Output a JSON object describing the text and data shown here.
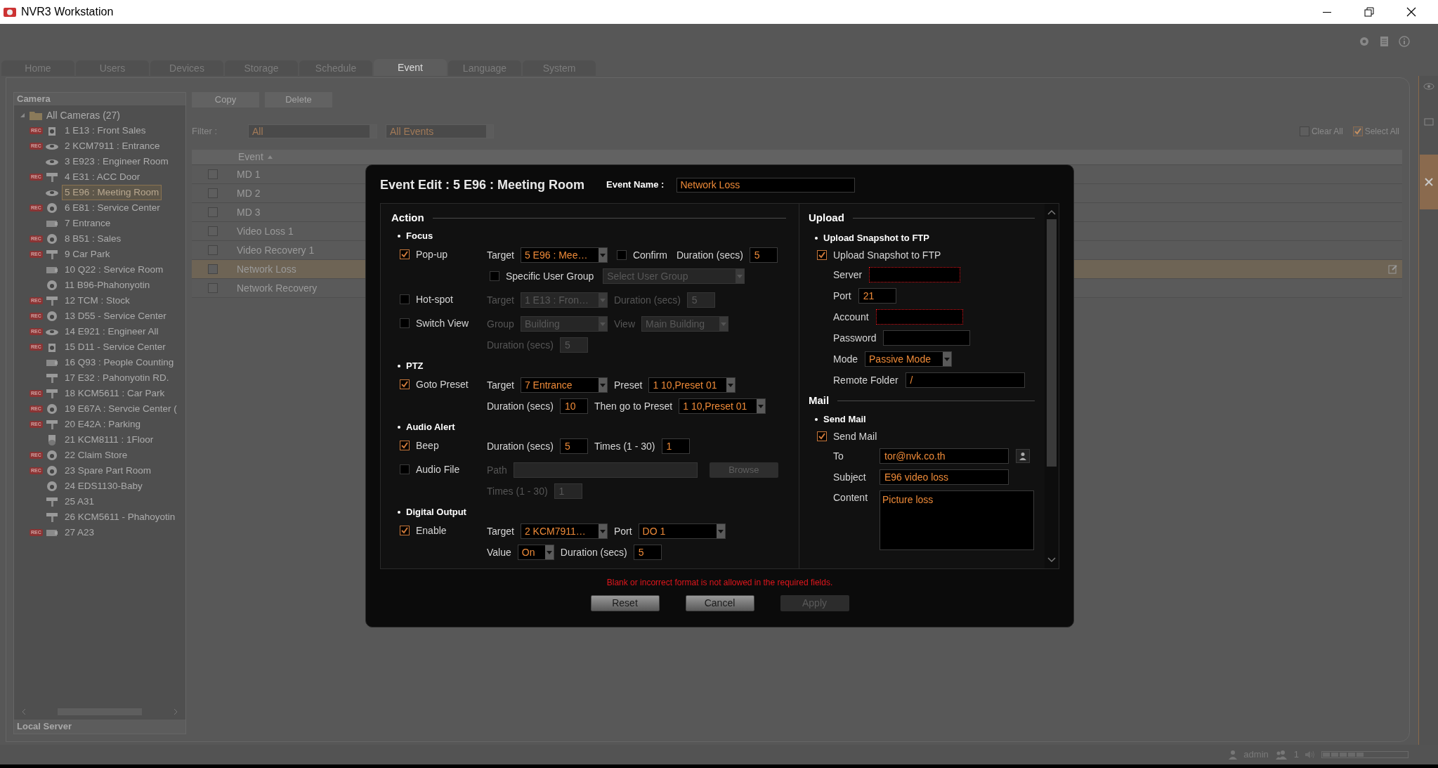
{
  "window": {
    "title": "NVR3 Workstation"
  },
  "tabs": [
    {
      "label": "Home",
      "selected": false
    },
    {
      "label": "Users",
      "selected": false
    },
    {
      "label": "Devices",
      "selected": false
    },
    {
      "label": "Storage",
      "selected": false
    },
    {
      "label": "Schedule",
      "selected": false
    },
    {
      "label": "Event",
      "selected": true
    },
    {
      "label": "Language",
      "selected": false
    },
    {
      "label": "System",
      "selected": false
    }
  ],
  "camera_panel": {
    "title": "Camera",
    "root": {
      "label": "All Cameras (27)",
      "expanded": true,
      "children": [
        {
          "label": "1 E13 : Front Sales",
          "badge": "REC",
          "kind": "cube",
          "selected": false
        },
        {
          "label": "2 KCM7911 : Entrance",
          "badge": "REC",
          "kind": "fisheye",
          "selected": false
        },
        {
          "label": "3 E923 : Engineer Room",
          "kind": "fisheye",
          "selected": false
        },
        {
          "label": "4 E31 : ACC Door",
          "badge": "REC",
          "kind": "bullet",
          "selected": false
        },
        {
          "label": "5 E96 : Meeting Room",
          "kind": "fisheye",
          "selected": true
        },
        {
          "label": "6 E81 : Service Center",
          "badge": "REC",
          "kind": "dome",
          "selected": false
        },
        {
          "label": "7 Entrance",
          "kind": "box",
          "selected": false
        },
        {
          "label": "8 B51 : Sales",
          "badge": "REC",
          "kind": "dome",
          "selected": false
        },
        {
          "label": "9 Car Park",
          "badge": "REC",
          "kind": "bullet",
          "selected": false
        },
        {
          "label": "10 Q22 : Service Room",
          "kind": "box",
          "selected": false
        },
        {
          "label": "11 B96-Phahonyotin",
          "kind": "dome",
          "selected": false
        },
        {
          "label": "12 TCM : Stock",
          "badge": "REC",
          "kind": "bullet",
          "selected": false
        },
        {
          "label": "13 D55 - Service Center",
          "badge": "REC",
          "kind": "dome",
          "selected": false
        },
        {
          "label": "14 E921 : Engineer All",
          "badge": "REC",
          "kind": "fisheye",
          "selected": false
        },
        {
          "label": "15 D11 - Service Center",
          "badge": "REC",
          "kind": "cube",
          "selected": false
        },
        {
          "label": "16 Q93 : People Counting",
          "kind": "box",
          "selected": false
        },
        {
          "label": "17 E32 : Pahonyotin RD.",
          "kind": "bullet",
          "selected": false
        },
        {
          "label": "18 KCM5611 : Car Park",
          "badge": "REC",
          "kind": "bullet",
          "selected": false
        },
        {
          "label": "19 E67A : Servcie Center (",
          "badge": "REC",
          "kind": "dome",
          "selected": false
        },
        {
          "label": "20 E42A : Parking",
          "badge": "REC",
          "kind": "bullet",
          "selected": false
        },
        {
          "label": "21 KCM8111 : 1Floor",
          "kind": "ptz",
          "selected": false
        },
        {
          "label": "22 Claim Store",
          "badge": "REC",
          "kind": "dome",
          "selected": false
        },
        {
          "label": "23 Spare Part Room",
          "badge": "REC",
          "kind": "dome",
          "selected": false
        },
        {
          "label": "24 EDS1130-Baby",
          "kind": "dome",
          "selected": false
        },
        {
          "label": "25 A31",
          "kind": "bullet",
          "selected": false
        },
        {
          "label": "26 KCM5611 - Phahoyotin",
          "kind": "bullet",
          "selected": false
        },
        {
          "label": "27 A23",
          "badge": "REC",
          "kind": "box",
          "selected": false
        }
      ]
    },
    "footer": "Local Server"
  },
  "toolbar": {
    "buttons": [
      "Copy",
      "Delete"
    ],
    "filter_label": "Filter :",
    "filters": [
      "All",
      "All Events"
    ],
    "toggles": [
      {
        "label": "Clear All",
        "checked": false
      },
      {
        "label": "Select All",
        "checked": true
      }
    ]
  },
  "table": {
    "columns": [
      "Event"
    ],
    "rows": [
      {
        "event": "MD 1",
        "checked": false,
        "selected": false
      },
      {
        "event": "MD 2",
        "checked": false,
        "selected": false
      },
      {
        "event": "MD 3",
        "checked": false,
        "selected": false
      },
      {
        "event": "Video Loss 1",
        "checked": false,
        "selected": false
      },
      {
        "event": "Video Recovery 1",
        "checked": false,
        "selected": false
      },
      {
        "event": "Network Loss",
        "checked": false,
        "selected": true
      },
      {
        "event": "Network Recovery",
        "checked": false,
        "selected": false
      }
    ]
  },
  "dialog": {
    "title": "Event Edit : 5 E96 : Meeting Room",
    "name_label": "Event Name :",
    "name_value": "Network Loss",
    "action": {
      "title": "Action",
      "sections": [
        {
          "title": "Focus",
          "items": [
            {
              "label": "Pop-up",
              "checked": true,
              "lines": [
                {
                  "fields": [
                    {
                      "kind": "label",
                      "text": "Target",
                      "disabled": false
                    },
                    {
                      "kind": "select",
                      "value": "5 E96 : Mee…",
                      "disabled": false
                    },
                    {
                      "kind": "checkbox",
                      "text": "Confirm",
                      "checked": false,
                      "disabled": false
                    },
                    {
                      "kind": "label",
                      "text": "Duration (secs)",
                      "disabled": false
                    },
                    {
                      "kind": "input",
                      "value": "5",
                      "disabled": false
                    }
                  ]
                },
                {
                  "fields": [
                    {
                      "kind": "checkbox",
                      "text": "Specific User Group",
                      "checked": false,
                      "disabled": false
                    },
                    {
                      "kind": "select",
                      "value": "Select User Group",
                      "disabled": true
                    }
                  ]
                }
              ]
            },
            {
              "label": "Hot-spot",
              "checked": false,
              "lines": [
                {
                  "fields": [
                    {
                      "kind": "label",
                      "text": "Target",
                      "disabled": true
                    },
                    {
                      "kind": "select",
                      "value": "1 E13 : Fron…",
                      "disabled": true
                    },
                    {
                      "kind": "label",
                      "text": "Duration (secs)",
                      "disabled": true
                    },
                    {
                      "kind": "input",
                      "value": "5",
                      "disabled": true
                    }
                  ]
                }
              ]
            },
            {
              "label": "Switch View",
              "checked": false,
              "lines": [
                {
                  "fields": [
                    {
                      "kind": "label",
                      "text": "Group",
                      "disabled": true
                    },
                    {
                      "kind": "select",
                      "value": "Building",
                      "disabled": true
                    },
                    {
                      "kind": "label",
                      "text": "View",
                      "disabled": true
                    },
                    {
                      "kind": "select",
                      "value": "Main Building",
                      "disabled": true
                    }
                  ]
                },
                {
                  "fields": [
                    {
                      "kind": "label",
                      "text": "Duration (secs)",
                      "disabled": true
                    },
                    {
                      "kind": "input",
                      "value": "5",
                      "disabled": true
                    }
                  ]
                }
              ]
            }
          ]
        },
        {
          "title": "PTZ",
          "items": [
            {
              "label": "Goto Preset",
              "checked": true,
              "lines": [
                {
                  "fields": [
                    {
                      "kind": "label",
                      "text": "Target",
                      "disabled": false
                    },
                    {
                      "kind": "select",
                      "value": "7 Entrance",
                      "disabled": false
                    },
                    {
                      "kind": "label",
                      "text": "Preset",
                      "disabled": false
                    },
                    {
                      "kind": "select",
                      "value": "1 10,Preset 01",
                      "disabled": false
                    }
                  ]
                },
                {
                  "fields": [
                    {
                      "kind": "label",
                      "text": "Duration (secs)",
                      "disabled": false
                    },
                    {
                      "kind": "input",
                      "value": "10",
                      "disabled": false
                    },
                    {
                      "kind": "label",
                      "text": "Then go to Preset",
                      "disabled": false
                    },
                    {
                      "kind": "select",
                      "value": "1 10,Preset 01",
                      "disabled": false
                    }
                  ]
                }
              ]
            }
          ]
        },
        {
          "title": "Audio Alert",
          "items": [
            {
              "label": "Beep",
              "checked": true,
              "lines": [
                {
                  "fields": [
                    {
                      "kind": "label",
                      "text": "Duration (secs)",
                      "disabled": false
                    },
                    {
                      "kind": "input",
                      "value": "5",
                      "disabled": false
                    },
                    {
                      "kind": "label",
                      "text": "Times (1 - 30)",
                      "disabled": false
                    },
                    {
                      "kind": "input",
                      "value": "1",
                      "disabled": false
                    }
                  ]
                }
              ]
            },
            {
              "label": "Audio File",
              "checked": false,
              "lines": [
                {
                  "fields": [
                    {
                      "kind": "label",
                      "text": "Path",
                      "disabled": true
                    },
                    {
                      "kind": "input",
                      "disabled": true
                    },
                    {
                      "kind": "button",
                      "text": "Browse",
                      "disabled": true
                    }
                  ]
                },
                {
                  "fields": [
                    {
                      "kind": "label",
                      "text": "Times (1 - 30)",
                      "disabled": true
                    },
                    {
                      "kind": "input",
                      "value": "1",
                      "disabled": true
                    }
                  ]
                }
              ]
            }
          ]
        },
        {
          "title": "Digital Output",
          "items": [
            {
              "label": "Enable",
              "checked": true,
              "lines": [
                {
                  "fields": [
                    {
                      "kind": "label",
                      "text": "Target",
                      "disabled": false
                    },
                    {
                      "kind": "select",
                      "value": "2 KCM7911…",
                      "disabled": false
                    },
                    {
                      "kind": "label",
                      "text": "Port",
                      "disabled": false
                    },
                    {
                      "kind": "select",
                      "value": "DO 1",
                      "disabled": false
                    }
                  ]
                },
                {
                  "fields": [
                    {
                      "kind": "label",
                      "text": "Value",
                      "disabled": false
                    },
                    {
                      "kind": "select",
                      "value": "On",
                      "disabled": false
                    },
                    {
                      "kind": "label",
                      "text": "Duration (secs)",
                      "disabled": false
                    },
                    {
                      "kind": "input",
                      "value": "5",
                      "disabled": false
                    }
                  ]
                }
              ]
            }
          ]
        }
      ]
    },
    "upload": {
      "title": "Upload",
      "section": "Upload Snapshot to FTP",
      "toggle": {
        "label": "Upload Snapshot to FTP",
        "checked": true
      },
      "fields": [
        {
          "label": "Server",
          "kind": "input",
          "invalid": true
        },
        {
          "label": "Port",
          "kind": "input",
          "value": "21",
          "invalid": false
        },
        {
          "label": "Account",
          "kind": "input",
          "invalid": true
        },
        {
          "label": "Password",
          "kind": "input",
          "invalid": false
        },
        {
          "label": "Mode",
          "kind": "select",
          "value": "Passive Mode",
          "invalid": false
        },
        {
          "label": "Remote Folder",
          "kind": "input",
          "value": "/",
          "invalid": false
        }
      ]
    },
    "mail": {
      "title": "Mail",
      "section": "Send Mail",
      "toggle": {
        "label": "Send Mail",
        "checked": true
      },
      "fields": [
        {
          "label": "To",
          "kind": "contact",
          "value": "tor@nvk.co.th"
        },
        {
          "label": "Subject",
          "kind": "input",
          "value": "E96 video loss"
        },
        {
          "label": "Content",
          "kind": "textarea",
          "value": "Picture loss"
        }
      ]
    },
    "error": "Blank or incorrect format is not allowed in the required fields.",
    "buttons": [
      {
        "label": "Reset",
        "disabled": false
      },
      {
        "label": "Cancel",
        "disabled": false
      },
      {
        "label": "Apply",
        "disabled": true
      }
    ]
  },
  "status_bar": {
    "user": "admin",
    "sessions": "1",
    "volume": {
      "level": 0.5
    }
  }
}
